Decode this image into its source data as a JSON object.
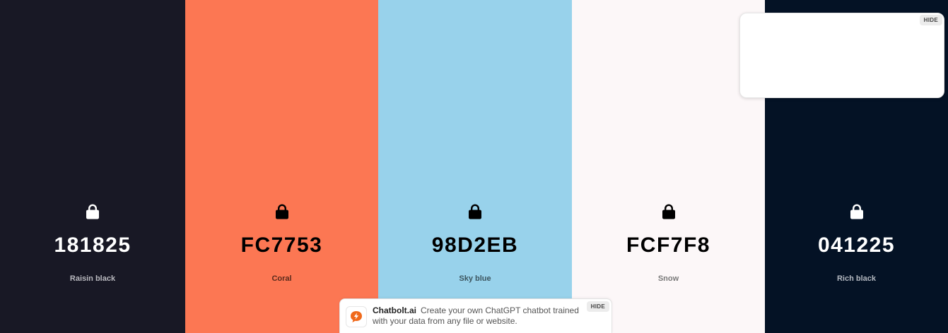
{
  "swatches": [
    {
      "hex": "181825",
      "name": "Raisin black",
      "bg": "#181825",
      "fg": "#ffffff",
      "name_color": "#b9b9bf"
    },
    {
      "hex": "FC7753",
      "name": "Coral",
      "bg": "#fc7753",
      "fg": "#000000",
      "name_color": "#5a2a1c"
    },
    {
      "hex": "98D2EB",
      "name": "Sky blue",
      "bg": "#98d2eb",
      "fg": "#000000",
      "name_color": "#3d5660"
    },
    {
      "hex": "FCF7F8",
      "name": "Snow",
      "bg": "#fcf7f8",
      "fg": "#000000",
      "name_color": "#7a7a7a"
    },
    {
      "hex": "041225",
      "name": "Rich black",
      "bg": "#041225",
      "fg": "#ffffff",
      "name_color": "#b3b8c0"
    }
  ],
  "lock_icon": "lock-icon",
  "ad_top": {
    "hide_label": "HIDE"
  },
  "ad_bottom": {
    "brand": "Chatbolt.ai",
    "text": "Create your own ChatGPT chatbot trained with your data from any file or website.",
    "hide_label": "HIDE",
    "logo_icon": "chatbolt-logo-icon",
    "logo_color": "#f06a1c"
  }
}
